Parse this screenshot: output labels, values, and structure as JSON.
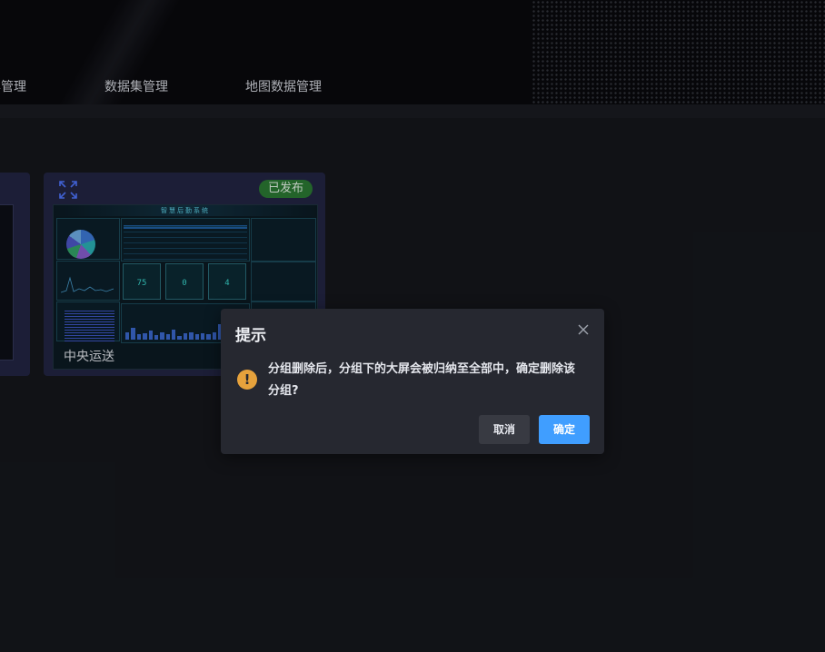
{
  "header": {
    "nav": [
      {
        "label": "屏管理"
      },
      {
        "label": "数据集管理"
      },
      {
        "label": "地图数据管理"
      }
    ]
  },
  "cards": [
    {
      "name": "中央运送",
      "status": "已发布",
      "status_color": "#2b7a34",
      "thumbnail": {
        "title": "智慧后勤系统",
        "gauges": [
          "75",
          "0",
          "4"
        ]
      }
    }
  ],
  "dialog": {
    "title": "提示",
    "message": "分组删除后，分组下的大屏会被归纳至全部中，确定删除该分组?",
    "cancel_label": "取消",
    "confirm_label": "确定",
    "warning_icon": "!",
    "accent_color": "#409eff",
    "warning_color": "#e6a23c"
  }
}
